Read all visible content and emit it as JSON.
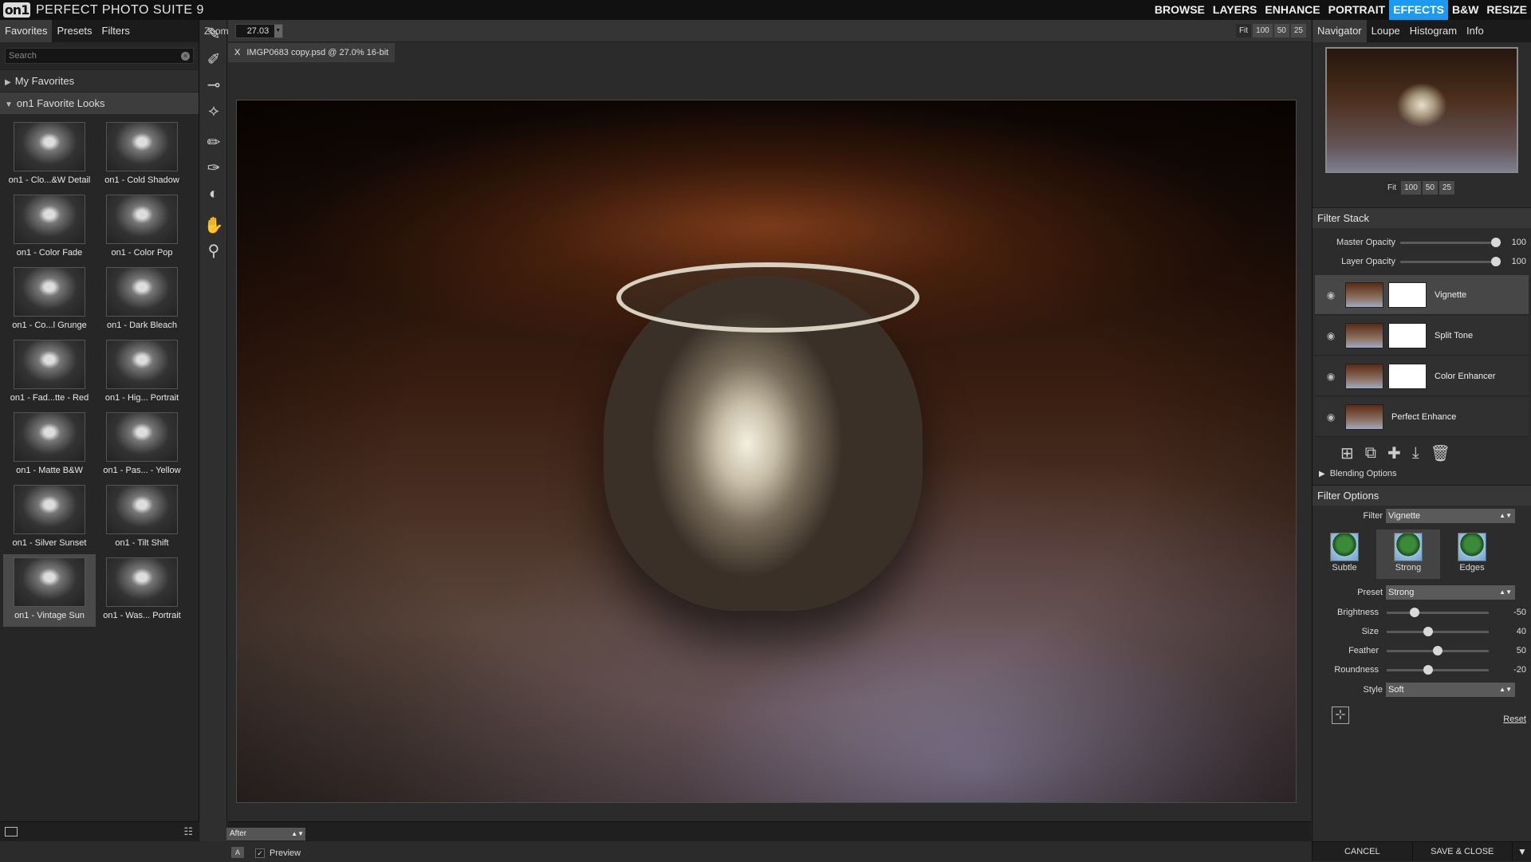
{
  "app": {
    "logo": "on1",
    "title": "PERFECT PHOTO SUITE 9"
  },
  "modules": [
    "BROWSE",
    "LAYERS",
    "ENHANCE",
    "PORTRAIT",
    "EFFECTS",
    "B&W",
    "RESIZE"
  ],
  "left": {
    "tabs": [
      "Favorites",
      "Presets",
      "Filters"
    ],
    "search_placeholder": "Search",
    "groups": {
      "my_favorites": "My Favorites",
      "favorite_looks": "on1 Favorite Looks"
    },
    "presets": [
      "on1 - Clo...&W Detail",
      "on1 - Cold Shadow",
      "on1 - Color Fade",
      "on1 - Color Pop",
      "on1 - Co...l Grunge",
      "on1 - Dark Bleach",
      "on1 - Fad...tte - Red",
      "on1 - Hig... Portrait",
      "on1 - Matte B&W",
      "on1 - Pas... - Yellow",
      "on1 - Silver Sunset",
      "on1 - Tilt Shift",
      "on1 - Vintage Sun",
      "on1 - Was... Portrait"
    ],
    "selected_index": 12
  },
  "center": {
    "zoom_label": "Zoom",
    "zoom_value": "27.03",
    "zoom_buttons": [
      "Fit",
      "100",
      "50",
      "25"
    ],
    "document_tab": "IMGP0683 copy.psd @ 27.0% 16-bit",
    "view_mode": "After",
    "preview_label": "Preview"
  },
  "right": {
    "tabs": [
      "Navigator",
      "Loupe",
      "Histogram",
      "Info"
    ],
    "nav_zoom": [
      "Fit",
      "100",
      "50",
      "25"
    ],
    "filter_stack": {
      "title": "Filter Stack",
      "master_opacity_label": "Master Opacity",
      "master_opacity": "100",
      "layer_opacity_label": "Layer Opacity",
      "layer_opacity": "100",
      "layers": [
        "Vignette",
        "Split Tone",
        "Color Enhancer",
        "Perfect Enhance"
      ],
      "blending_options": "Blending Options"
    },
    "filter_options": {
      "title": "Filter Options",
      "filter_label": "Filter",
      "filter_value": "Vignette",
      "presets": [
        "Subtle",
        "Strong",
        "Edges"
      ],
      "preset_label": "Preset",
      "preset_value": "Strong",
      "sliders": [
        {
          "label": "Brightness",
          "value": "-50",
          "pos": 0.25
        },
        {
          "label": "Size",
          "value": "40",
          "pos": 0.4
        },
        {
          "label": "Feather",
          "value": "50",
          "pos": 0.5
        },
        {
          "label": "Roundness",
          "value": "-20",
          "pos": 0.4
        }
      ],
      "style_label": "Style",
      "style_value": "Soft",
      "reset": "Reset"
    },
    "footer": {
      "cancel": "CANCEL",
      "save": "SAVE & CLOSE"
    }
  }
}
